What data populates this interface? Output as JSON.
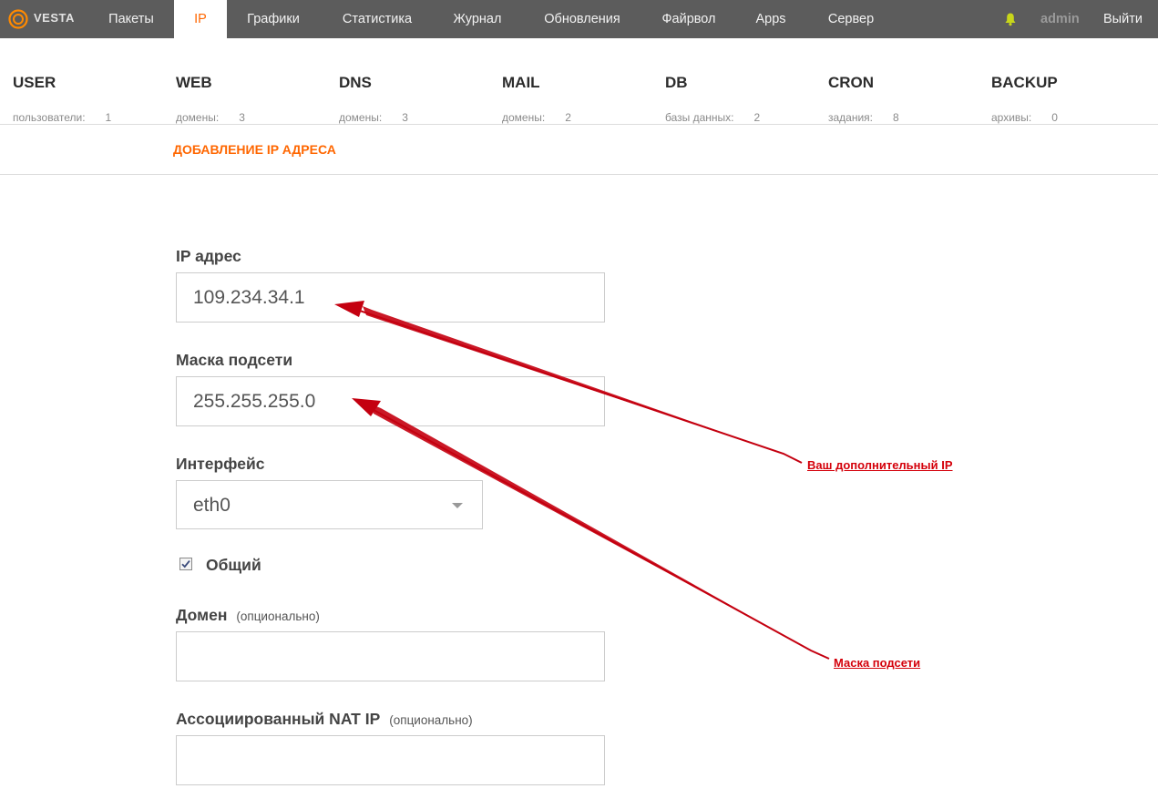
{
  "header": {
    "logo_text": "VESTA",
    "nav": [
      {
        "label": "Пакеты"
      },
      {
        "label": "IP"
      },
      {
        "label": "Графики"
      },
      {
        "label": "Статистика"
      },
      {
        "label": "Журнал"
      },
      {
        "label": "Обновления"
      },
      {
        "label": "Файрвол"
      },
      {
        "label": "Apps"
      },
      {
        "label": "Сервер"
      }
    ],
    "active_tab": "IP",
    "notification_icon": "bell-icon",
    "user": "admin",
    "logout": "Выйти"
  },
  "stats": [
    {
      "title": "USER",
      "label": "пользователи:",
      "value": "1"
    },
    {
      "title": "WEB",
      "label": "домены:",
      "value": "3"
    },
    {
      "title": "DNS",
      "label": "домены:",
      "value": "3"
    },
    {
      "title": "MAIL",
      "label": "домены:",
      "value": "2"
    },
    {
      "title": "DB",
      "label": "базы данных:",
      "value": "2"
    },
    {
      "title": "CRON",
      "label": "задания:",
      "value": "8"
    },
    {
      "title": "BACKUP",
      "label": "архивы:",
      "value": "0"
    }
  ],
  "page_title": "ДОБАВЛЕНИЕ IP АДРЕСА",
  "form": {
    "ip_label": "IP адрес",
    "ip_value": "109.234.34.1",
    "mask_label": "Маска подсети",
    "mask_value": "255.255.255.0",
    "interface_label": "Интерфейс",
    "interface_value": "eth0",
    "shared_label": "Общий",
    "shared_checked": true,
    "domain_label": "Домен",
    "domain_optional": "(опционально)",
    "domain_value": "",
    "nat_label": "Ассоциированный NAT IP",
    "nat_optional": "(опционально)",
    "nat_value": ""
  },
  "annotations": {
    "ip_callout": "Ваш дополнительный IP",
    "mask_callout": "Маска подсети",
    "color": "#d4000a"
  },
  "colors": {
    "accent": "#ff6701",
    "topbar": "#5c5c5c"
  }
}
